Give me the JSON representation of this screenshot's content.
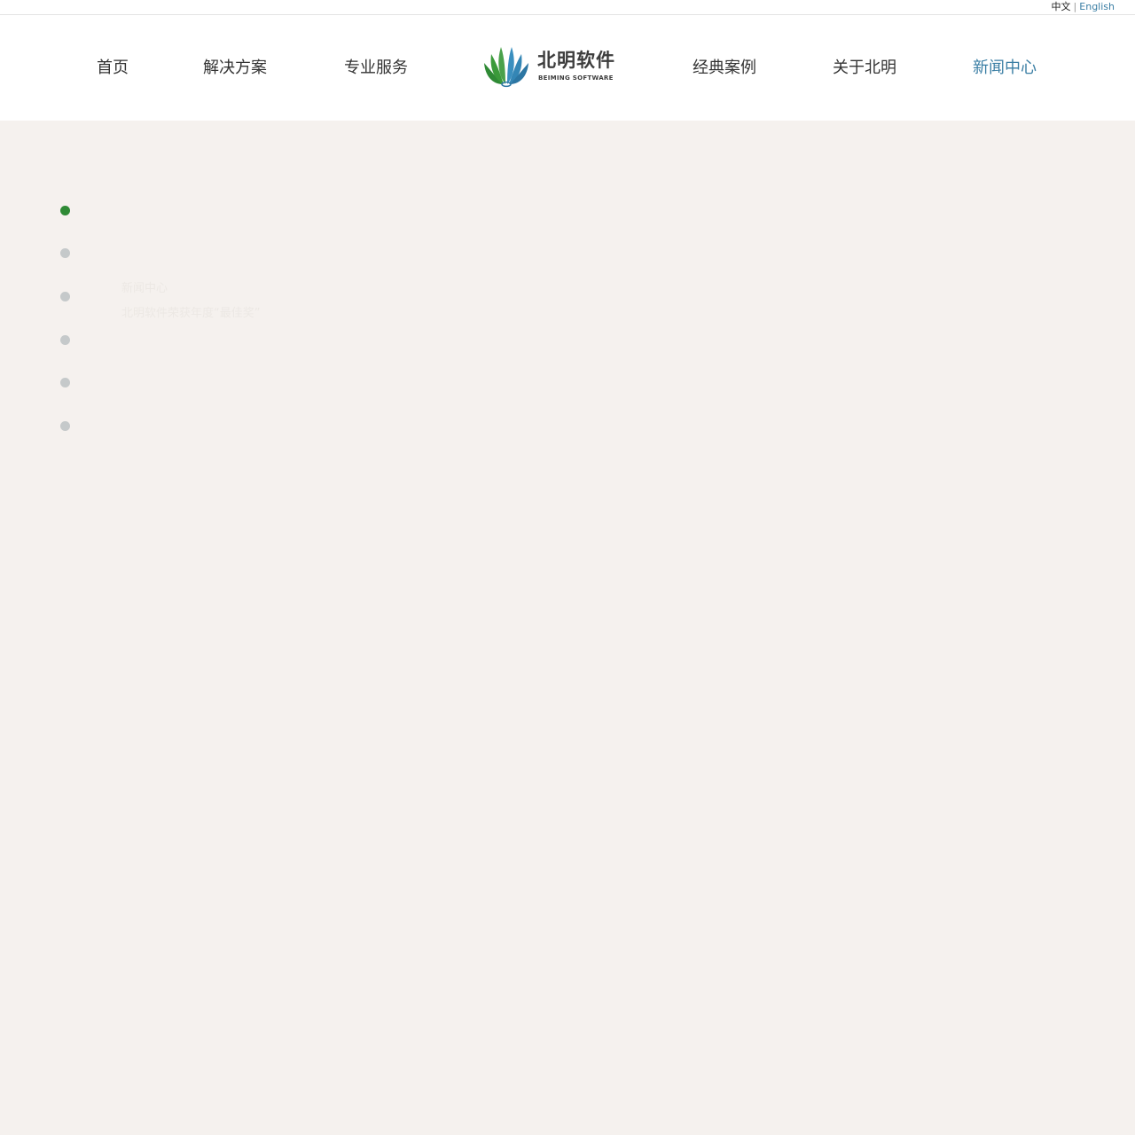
{
  "language_switch": {
    "chinese": "中文",
    "separator": "|",
    "english": "English"
  },
  "nav": {
    "items": [
      {
        "label": "首页"
      },
      {
        "label": "解决方案"
      },
      {
        "label": "专业服务"
      },
      {
        "label": "经典案例"
      },
      {
        "label": "关于北明"
      },
      {
        "label": "新闻中心",
        "active": true
      }
    ]
  },
  "logo": {
    "name_cn": "北明软件",
    "name_en": "BEIMING SOFTWARE",
    "colors": {
      "green": "#2f8a35",
      "blue": "#3a8fbf"
    }
  },
  "slider": {
    "dot_count": 6,
    "active_index": 0,
    "active_color": "#2f8a35",
    "inactive_color": "#c5c9ca",
    "caption_title": "新闻中心",
    "caption_subtitle": "北明软件荣获年度“最佳奖”"
  },
  "colors": {
    "accent": "#3a7ea4",
    "background": "#f5f1ee"
  }
}
